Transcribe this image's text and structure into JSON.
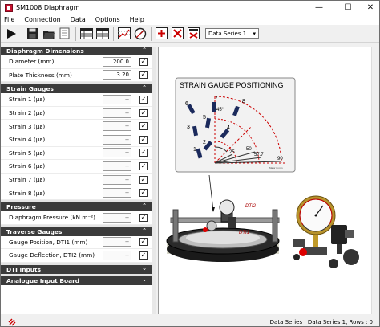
{
  "window": {
    "title": "SM1008 Diaphragm"
  },
  "menu": [
    "File",
    "Connection",
    "Data",
    "Options",
    "Help"
  ],
  "toolbar": {
    "icons": [
      "play-icon",
      "save-icon",
      "open-folder-icon",
      "export-icon",
      "table-icon",
      "table-icon-2",
      "grid-chart-icon",
      "gauge-settings-icon",
      "add-icon",
      "delete-icon",
      "clear-icon"
    ],
    "data_series": "Data Series 1"
  },
  "sections": {
    "diaphragm": {
      "title": "Diaphragm Dimensions",
      "rows": [
        {
          "label": "Diameter  (mm)",
          "value": "200.0"
        },
        {
          "label": "Plate Thickness  (mm)",
          "value": "3.20"
        }
      ]
    },
    "strain": {
      "title": "Strain Gauges",
      "rows": [
        {
          "label": "Strain 1  (µε)",
          "value": "--"
        },
        {
          "label": "Strain 2  (µε)",
          "value": "--"
        },
        {
          "label": "Strain 3  (µε)",
          "value": "--"
        },
        {
          "label": "Strain 4  (µε)",
          "value": "--"
        },
        {
          "label": "Strain 5  (µε)",
          "value": "--"
        },
        {
          "label": "Strain 6  (µε)",
          "value": "--"
        },
        {
          "label": "Strain 7  (µε)",
          "value": "--"
        },
        {
          "label": "Strain 8  (µε)",
          "value": "--"
        }
      ]
    },
    "pressure": {
      "title": "Pressure",
      "rows": [
        {
          "label": "Diaphragm Pressure  (kN.m⁻²)",
          "value": "--"
        }
      ]
    },
    "traverse": {
      "title": "Traverse Gauges",
      "rows": [
        {
          "label": "Gauge Position, DTI1  (mm)",
          "value": "--"
        },
        {
          "label": "Gauge Deflection, DTI2  (mm)",
          "value": "--"
        }
      ]
    },
    "dti": {
      "title": "DTI Inputs"
    },
    "analogue": {
      "title": "Analogue Input Board"
    }
  },
  "diagram": {
    "title": "STRAIN GAUGE POSITIONING",
    "gauge_numbers": [
      "1",
      "2",
      "3",
      "4",
      "5",
      "6",
      "7",
      "8"
    ],
    "angle": "45°",
    "radii": [
      "25",
      "50",
      "57.7",
      "90"
    ],
    "note": "Major in mm",
    "dti2": "DTI2",
    "dti1": "DTI1"
  },
  "status": {
    "text": "Data Series : Data Series 1,  Rows : 0"
  }
}
